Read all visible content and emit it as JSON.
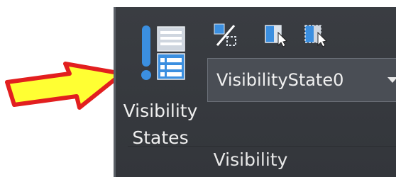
{
  "ribbon": {
    "visibility_states_label": "Visibility States",
    "dropdown_value": "VisibilityState0",
    "group_label": "Visibility"
  },
  "icons": {
    "visibility_states": "visibility-states-icon",
    "toggle": "visibility-mode-icon",
    "make_visible": "make-visible-icon",
    "make_invisible": "make-invisible-icon",
    "arrow": "pointer-arrow"
  },
  "colors": {
    "ribbon_bg": "#383b40",
    "icon_blue": "#3b8fe0",
    "arrow_fill": "#ffff33",
    "arrow_stroke": "#e21f1f"
  }
}
